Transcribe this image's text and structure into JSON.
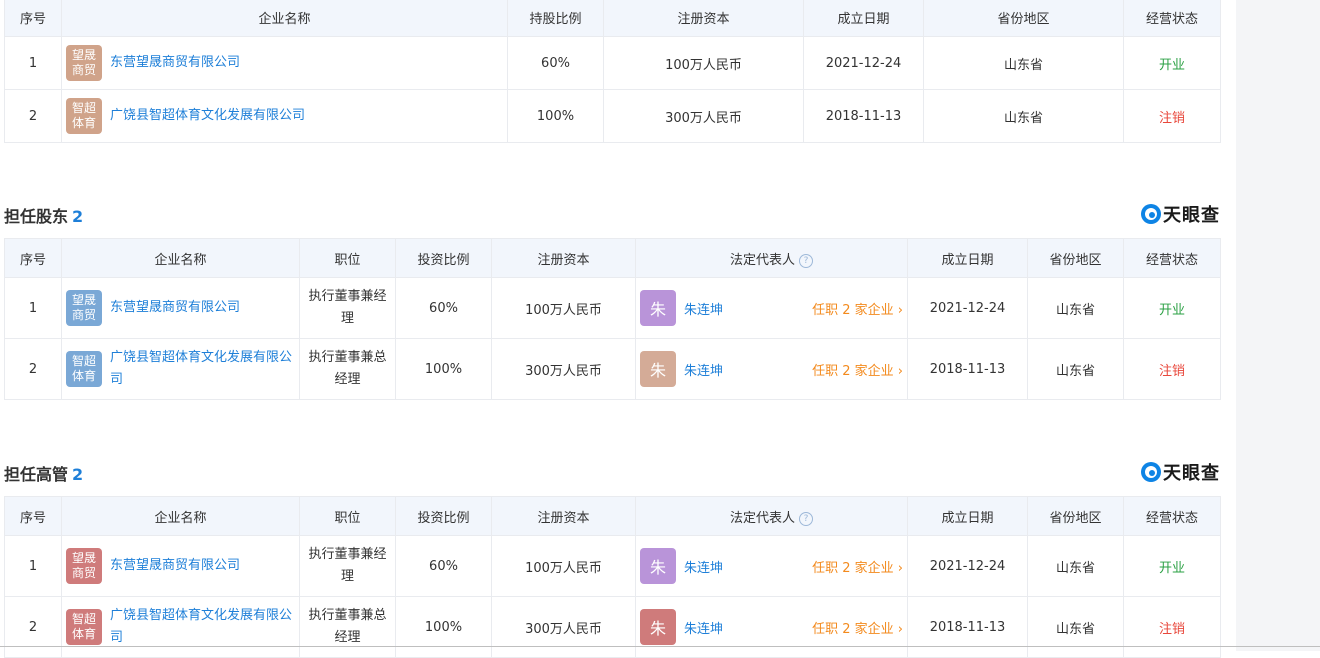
{
  "colors": {
    "accent": "#1e7fd8",
    "open": "#2aa043",
    "cancel": "#e8473b",
    "roles": "#f38a1d",
    "header_bg": "#f2f6fc"
  },
  "table1": {
    "headers": [
      "序号",
      "企业名称",
      "持股比例",
      "注册资本",
      "成立日期",
      "省份地区",
      "经营状态"
    ],
    "rows": [
      {
        "no": "1",
        "logo_text": "望晟商贸",
        "logo_color": "#d0a38a",
        "company": "东营望晟商贸有限公司",
        "ratio": "60%",
        "capital": "100万人民币",
        "date": "2021-12-24",
        "province": "山东省",
        "status": "开业",
        "status_kind": "open"
      },
      {
        "no": "2",
        "logo_text": "智超体育",
        "logo_color": "#d0a38a",
        "company": "广饶县智超体育文化发展有限公司",
        "ratio": "100%",
        "capital": "300万人民币",
        "date": "2018-11-13",
        "province": "山东省",
        "status": "注销",
        "status_kind": "cancel"
      }
    ]
  },
  "section2": {
    "title": "担任股东",
    "count": "2",
    "brand": "天眼查",
    "headers": [
      "序号",
      "企业名称",
      "职位",
      "投资比例",
      "注册资本",
      "法定代表人",
      "成立日期",
      "省份地区",
      "经营状态"
    ],
    "rows": [
      {
        "no": "1",
        "logo_text": "望晟商贸",
        "logo_color": "#7aa8d6",
        "company": "东营望晟商贸有限公司",
        "position": "执行董事兼经理",
        "ratio": "60%",
        "capital": "100万人民币",
        "avatar": "朱",
        "avatar_color": "#b994d9",
        "rep": "朱连坤",
        "roles": "任职 2 家企业",
        "date": "2021-12-24",
        "province": "山东省",
        "status": "开业",
        "status_kind": "open"
      },
      {
        "no": "2",
        "logo_text": "智超体育",
        "logo_color": "#7aa8d6",
        "company": "广饶县智超体育文化发展有限公司",
        "position": "执行董事兼总经理",
        "ratio": "100%",
        "capital": "300万人民币",
        "avatar": "朱",
        "avatar_color": "#d4ab97",
        "rep": "朱连坤",
        "roles": "任职 2 家企业",
        "date": "2018-11-13",
        "province": "山东省",
        "status": "注销",
        "status_kind": "cancel"
      }
    ]
  },
  "section3": {
    "title": "担任高管",
    "count": "2",
    "brand": "天眼查",
    "headers": [
      "序号",
      "企业名称",
      "职位",
      "投资比例",
      "注册资本",
      "法定代表人",
      "成立日期",
      "省份地区",
      "经营状态"
    ],
    "rows": [
      {
        "no": "1",
        "logo_text": "望晟商贸",
        "logo_color": "#cf7b7b",
        "company": "东营望晟商贸有限公司",
        "position": "执行董事兼经理",
        "ratio": "60%",
        "capital": "100万人民币",
        "avatar": "朱",
        "avatar_color": "#b994d9",
        "rep": "朱连坤",
        "roles": "任职 2 家企业",
        "date": "2021-12-24",
        "province": "山东省",
        "status": "开业",
        "status_kind": "open"
      },
      {
        "no": "2",
        "logo_text": "智超体育",
        "logo_color": "#cf7b7b",
        "company": "广饶县智超体育文化发展有限公司",
        "position": "执行董事兼总经理",
        "ratio": "100%",
        "capital": "300万人民币",
        "avatar": "朱",
        "avatar_color": "#cf7b7b",
        "rep": "朱连坤",
        "roles": "任职 2 家企业",
        "date": "2018-11-13",
        "province": "山东省",
        "status": "注销",
        "status_kind": "cancel"
      }
    ]
  }
}
